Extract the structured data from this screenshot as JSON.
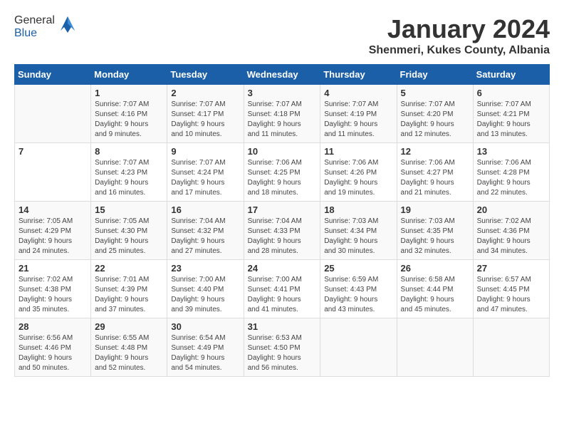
{
  "header": {
    "logo_general": "General",
    "logo_blue": "Blue",
    "month_title": "January 2024",
    "location": "Shenmeri, Kukes County, Albania"
  },
  "weekdays": [
    "Sunday",
    "Monday",
    "Tuesday",
    "Wednesday",
    "Thursday",
    "Friday",
    "Saturday"
  ],
  "weeks": [
    [
      {
        "day": "",
        "content": ""
      },
      {
        "day": "1",
        "content": "Sunrise: 7:07 AM\nSunset: 4:16 PM\nDaylight: 9 hours\nand 9 minutes."
      },
      {
        "day": "2",
        "content": "Sunrise: 7:07 AM\nSunset: 4:17 PM\nDaylight: 9 hours\nand 10 minutes."
      },
      {
        "day": "3",
        "content": "Sunrise: 7:07 AM\nSunset: 4:18 PM\nDaylight: 9 hours\nand 11 minutes."
      },
      {
        "day": "4",
        "content": "Sunrise: 7:07 AM\nSunset: 4:19 PM\nDaylight: 9 hours\nand 11 minutes."
      },
      {
        "day": "5",
        "content": "Sunrise: 7:07 AM\nSunset: 4:20 PM\nDaylight: 9 hours\nand 12 minutes."
      },
      {
        "day": "6",
        "content": "Sunrise: 7:07 AM\nSunset: 4:21 PM\nDaylight: 9 hours\nand 13 minutes."
      }
    ],
    [
      {
        "day": "7",
        "content": ""
      },
      {
        "day": "8",
        "content": "Sunrise: 7:07 AM\nSunset: 4:23 PM\nDaylight: 9 hours\nand 16 minutes."
      },
      {
        "day": "9",
        "content": "Sunrise: 7:07 AM\nSunset: 4:24 PM\nDaylight: 9 hours\nand 17 minutes."
      },
      {
        "day": "10",
        "content": "Sunrise: 7:06 AM\nSunset: 4:25 PM\nDaylight: 9 hours\nand 18 minutes."
      },
      {
        "day": "11",
        "content": "Sunrise: 7:06 AM\nSunset: 4:26 PM\nDaylight: 9 hours\nand 19 minutes."
      },
      {
        "day": "12",
        "content": "Sunrise: 7:06 AM\nSunset: 4:27 PM\nDaylight: 9 hours\nand 21 minutes."
      },
      {
        "day": "13",
        "content": "Sunrise: 7:06 AM\nSunset: 4:28 PM\nDaylight: 9 hours\nand 22 minutes."
      }
    ],
    [
      {
        "day": "14",
        "content": "Sunrise: 7:05 AM\nSunset: 4:29 PM\nDaylight: 9 hours\nand 24 minutes."
      },
      {
        "day": "15",
        "content": "Sunrise: 7:05 AM\nSunset: 4:30 PM\nDaylight: 9 hours\nand 25 minutes."
      },
      {
        "day": "16",
        "content": "Sunrise: 7:04 AM\nSunset: 4:32 PM\nDaylight: 9 hours\nand 27 minutes."
      },
      {
        "day": "17",
        "content": "Sunrise: 7:04 AM\nSunset: 4:33 PM\nDaylight: 9 hours\nand 28 minutes."
      },
      {
        "day": "18",
        "content": "Sunrise: 7:03 AM\nSunset: 4:34 PM\nDaylight: 9 hours\nand 30 minutes."
      },
      {
        "day": "19",
        "content": "Sunrise: 7:03 AM\nSunset: 4:35 PM\nDaylight: 9 hours\nand 32 minutes."
      },
      {
        "day": "20",
        "content": "Sunrise: 7:02 AM\nSunset: 4:36 PM\nDaylight: 9 hours\nand 34 minutes."
      }
    ],
    [
      {
        "day": "21",
        "content": "Sunrise: 7:02 AM\nSunset: 4:38 PM\nDaylight: 9 hours\nand 35 minutes."
      },
      {
        "day": "22",
        "content": "Sunrise: 7:01 AM\nSunset: 4:39 PM\nDaylight: 9 hours\nand 37 minutes."
      },
      {
        "day": "23",
        "content": "Sunrise: 7:00 AM\nSunset: 4:40 PM\nDaylight: 9 hours\nand 39 minutes."
      },
      {
        "day": "24",
        "content": "Sunrise: 7:00 AM\nSunset: 4:41 PM\nDaylight: 9 hours\nand 41 minutes."
      },
      {
        "day": "25",
        "content": "Sunrise: 6:59 AM\nSunset: 4:43 PM\nDaylight: 9 hours\nand 43 minutes."
      },
      {
        "day": "26",
        "content": "Sunrise: 6:58 AM\nSunset: 4:44 PM\nDaylight: 9 hours\nand 45 minutes."
      },
      {
        "day": "27",
        "content": "Sunrise: 6:57 AM\nSunset: 4:45 PM\nDaylight: 9 hours\nand 47 minutes."
      }
    ],
    [
      {
        "day": "28",
        "content": "Sunrise: 6:56 AM\nSunset: 4:46 PM\nDaylight: 9 hours\nand 50 minutes."
      },
      {
        "day": "29",
        "content": "Sunrise: 6:55 AM\nSunset: 4:48 PM\nDaylight: 9 hours\nand 52 minutes."
      },
      {
        "day": "30",
        "content": "Sunrise: 6:54 AM\nSunset: 4:49 PM\nDaylight: 9 hours\nand 54 minutes."
      },
      {
        "day": "31",
        "content": "Sunrise: 6:53 AM\nSunset: 4:50 PM\nDaylight: 9 hours\nand 56 minutes."
      },
      {
        "day": "",
        "content": ""
      },
      {
        "day": "",
        "content": ""
      },
      {
        "day": "",
        "content": ""
      }
    ]
  ]
}
